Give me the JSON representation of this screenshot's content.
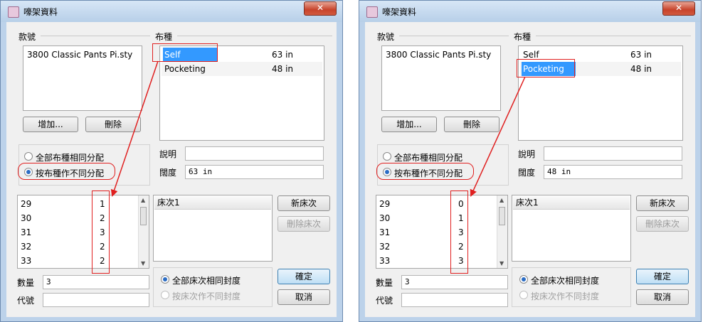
{
  "windows": [
    {
      "title": "嚎架資料",
      "close_label": "✕",
      "style_label": "款號",
      "fabric_label": "布種",
      "styles": [
        "3800 Classic Pants Pi.sty"
      ],
      "fabrics": [
        {
          "name": "Self",
          "width": "63 in"
        },
        {
          "name": "Pocketing",
          "width": "48 in"
        }
      ],
      "selected_fabric": 0,
      "add_label": "增加...",
      "delete_label": "刪除",
      "radio_all_fabric": "全部布種相同分配",
      "radio_by_fabric": "按布種作不同分配",
      "desc_label": "說明",
      "desc_value": "",
      "width_label": "闊度",
      "width_value": "63 in",
      "sizes": [
        {
          "size": "29",
          "qty": "1"
        },
        {
          "size": "30",
          "qty": "2"
        },
        {
          "size": "31",
          "qty": "3"
        },
        {
          "size": "32",
          "qty": "2"
        },
        {
          "size": "33",
          "qty": "2"
        }
      ],
      "bed_header": "床次1",
      "new_bed_label": "新床次",
      "delete_bed_label": "刪除床次",
      "qty_label": "數量",
      "qty_value": "3",
      "code_label": "代號",
      "code_value": "",
      "radio_all_bed": "全部床次相同封度",
      "radio_by_bed": "按床次作不同封度",
      "ok_label": "確定",
      "cancel_label": "取消"
    },
    {
      "title": "嚎架資料",
      "close_label": "✕",
      "style_label": "款號",
      "fabric_label": "布種",
      "styles": [
        "3800 Classic Pants Pi.sty"
      ],
      "fabrics": [
        {
          "name": "Self",
          "width": "63 in"
        },
        {
          "name": "Pocketing",
          "width": "48 in"
        }
      ],
      "selected_fabric": 1,
      "add_label": "增加...",
      "delete_label": "刪除",
      "radio_all_fabric": "全部布種相同分配",
      "radio_by_fabric": "按布種作不同分配",
      "desc_label": "說明",
      "desc_value": "",
      "width_label": "闊度",
      "width_value": "48 in",
      "sizes": [
        {
          "size": "29",
          "qty": "0"
        },
        {
          "size": "30",
          "qty": "1"
        },
        {
          "size": "31",
          "qty": "3"
        },
        {
          "size": "32",
          "qty": "2"
        },
        {
          "size": "33",
          "qty": "3"
        }
      ],
      "bed_header": "床次1",
      "new_bed_label": "新床次",
      "delete_bed_label": "刪除床次",
      "qty_label": "數量",
      "qty_value": "3",
      "code_label": "代號",
      "code_value": "",
      "radio_all_bed": "全部床次相同封度",
      "radio_by_bed": "按床次作不同封度",
      "ok_label": "確定",
      "cancel_label": "取消"
    }
  ],
  "colors": {
    "annotation": "#e02020",
    "selection": "#3399ff",
    "window_frame": "#bcd2ea"
  }
}
